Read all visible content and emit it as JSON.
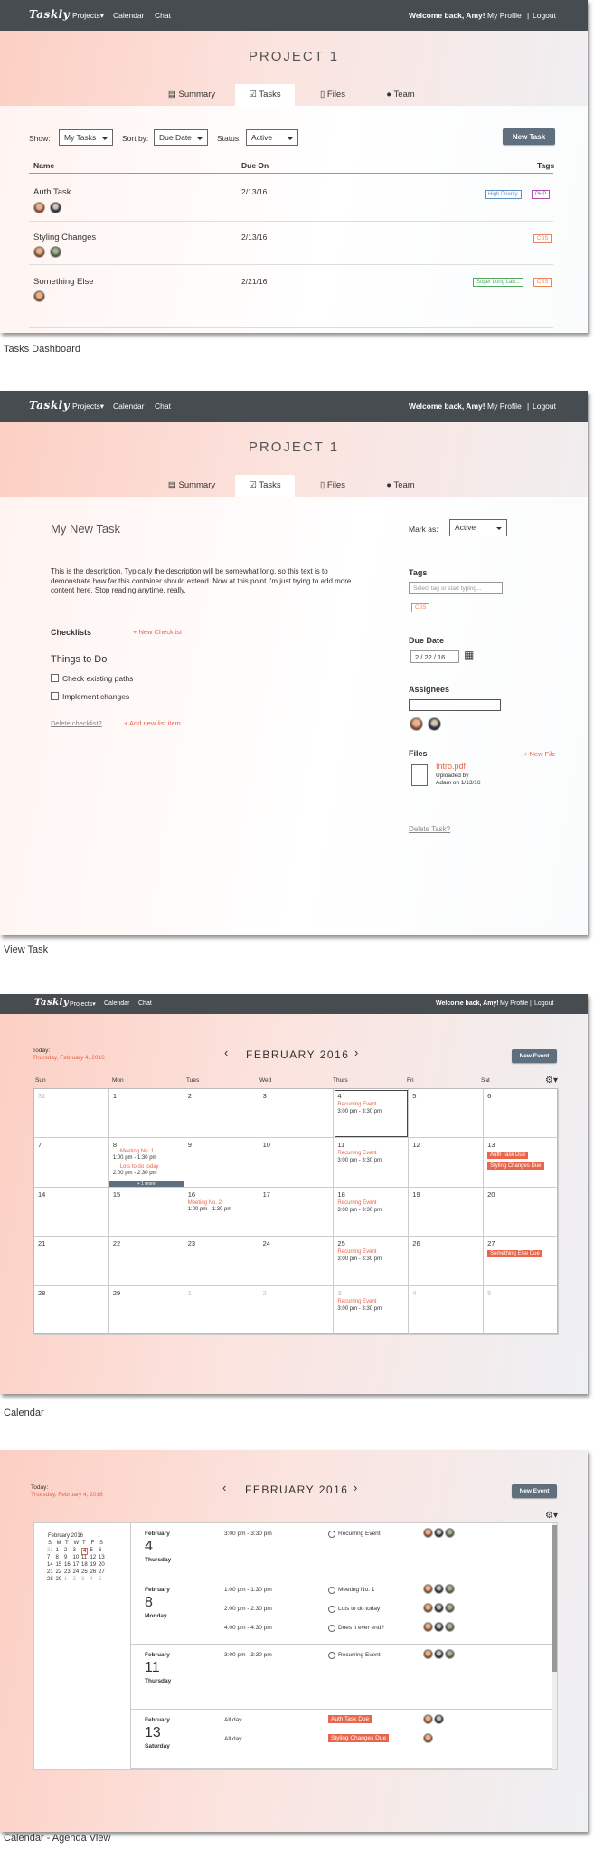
{
  "nav": {
    "logo": "Taskly",
    "projects": "Projects",
    "calendar": "Calendar",
    "chat": "Chat",
    "welcome": "Welcome back, Amy!",
    "my_profile": "My Profile",
    "separator": "|",
    "logout": "Logout"
  },
  "project_title": "PROJECT 1",
  "tabs": {
    "summary": "Summary",
    "tasks": "Tasks",
    "files": "Files",
    "team": "Team"
  },
  "dashboard": {
    "show_label": "Show:",
    "show_value": "My Tasks",
    "sort_label": "Sort by:",
    "sort_value": "Due Date",
    "status_label": "Status:",
    "status_value": "Active",
    "new_task": "New Task",
    "col_name": "Name",
    "col_due": "Due On",
    "col_tags": "Tags",
    "rows": [
      {
        "name": "Auth Task",
        "due": "2/13/16",
        "tags": [
          "High Priority",
          "PHP"
        ]
      },
      {
        "name": "Styling Changes",
        "due": "2/13/16",
        "tags": [
          "CSS"
        ]
      },
      {
        "name": "Something Else",
        "due": "2/21/16",
        "tags": [
          "Super Long Lab...",
          "CSS"
        ]
      }
    ],
    "caption": "Tasks Dashboard"
  },
  "view_task": {
    "title": "My New Task",
    "mark_as": "Mark as:",
    "status": "Active",
    "description": "This is the description. Typically the description will be somewhat long, so this text is to demonstrate how far this container should extend. Now at this point I'm just trying to add more content here. Stop reading anytime, really.",
    "checklists": "Checklists",
    "new_checklist": "+ New Checklist",
    "things_to_do": "Things to Do",
    "items": [
      "Check existing paths",
      "Implement changes"
    ],
    "delete_checklist": "Delete checklist?",
    "add_list_item": "+ Add new list item",
    "tags_label": "Tags",
    "tags_placeholder": "Select tag or start typing...",
    "tag": "CSS",
    "due_label": "Due Date",
    "due_value": "2 / 22 / 16",
    "assignees": "Assignees",
    "files_label": "Files",
    "new_file": "+ New File",
    "file_name": "Intro.pdf",
    "uploaded_by": "Uploaded by",
    "uploaded_on": "Adam on 1/13/16",
    "delete_task": "Delete Task?",
    "caption": "View Task"
  },
  "calendar": {
    "today": "Today:",
    "today_date": "Thursday, February 4, 2016",
    "month": "FEBRUARY 2016",
    "new_event": "New Event",
    "weekdays": [
      "Sun",
      "Mon",
      "Tues",
      "Wed",
      "Thurs",
      "Fri",
      "Sat"
    ],
    "days": [
      "31",
      "1",
      "2",
      "3",
      "4",
      "5",
      "6",
      "7",
      "8",
      "9",
      "10",
      "11",
      "12",
      "13",
      "14",
      "15",
      "16",
      "17",
      "18",
      "19",
      "20",
      "21",
      "22",
      "23",
      "24",
      "25",
      "26",
      "27",
      "28",
      "29",
      "1",
      "2",
      "3",
      "4",
      "5"
    ],
    "recurring": "Recurring Event",
    "recurring_time": "3:00 pm - 3:30 pm",
    "meeting1": "Meeting No. 1",
    "meeting1_time": "1:00 pm - 1:30 pm",
    "lots": "Lots to do today",
    "lots_time": "2:00 pm - 2:30 pm",
    "more": "+ 1 more",
    "meeting2": "Meeting No. 2",
    "meeting2_time": "1:00 pm - 1:30 pm",
    "auth_due": "Auth Task Due",
    "styling_due": "Styling Changes Due",
    "something_due": "Something Else Due",
    "caption": "Calendar"
  },
  "agenda": {
    "mini_month": "February 2016",
    "mini_weekdays": [
      "S",
      "M",
      "T",
      "W",
      "T",
      "F",
      "S"
    ],
    "mini_days": [
      "31",
      "1",
      "2",
      "3",
      "4",
      "5",
      "6",
      "7",
      "8",
      "9",
      "10",
      "11",
      "12",
      "13",
      "14",
      "15",
      "16",
      "17",
      "18",
      "19",
      "20",
      "21",
      "22",
      "23",
      "24",
      "25",
      "26",
      "27",
      "28",
      "29",
      "1",
      "2",
      "3",
      "4",
      "5"
    ],
    "groups": [
      {
        "month": "February",
        "day": "4",
        "weekday": "Thursday",
        "events": [
          {
            "time": "3:00 pm - 3:30 pm",
            "title": "Recurring Event"
          }
        ]
      },
      {
        "month": "February",
        "day": "8",
        "weekday": "Monday",
        "events": [
          {
            "time": "1:00 pm - 1:30 pm",
            "title": "Meeting No. 1"
          },
          {
            "time": "2:00 pm - 2:30 pm",
            "title": "Lots to do today"
          },
          {
            "time": "4:00 pm - 4:30 pm",
            "title": "Does it ever end?"
          }
        ]
      },
      {
        "month": "February",
        "day": "11",
        "weekday": "Thursday",
        "events": [
          {
            "time": "3:00 pm - 3:30 pm",
            "title": "Recurring Event"
          }
        ]
      },
      {
        "month": "February",
        "day": "13",
        "weekday": "Saturday",
        "events": [
          {
            "time": "All day",
            "title": "Auth Task Due"
          },
          {
            "time": "All day",
            "title": "Styling Changes Due"
          }
        ]
      }
    ],
    "caption": "Calendar - Agenda View"
  }
}
